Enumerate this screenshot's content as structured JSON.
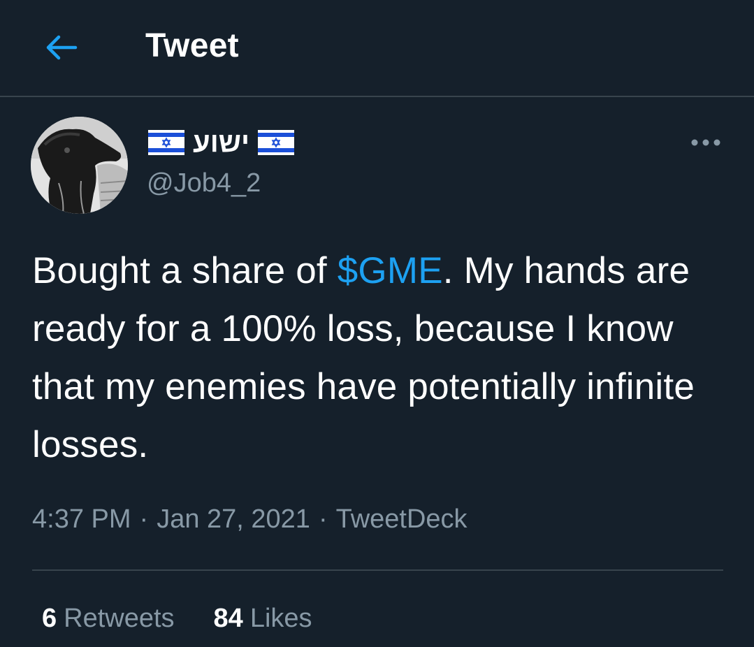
{
  "header": {
    "back_icon": "arrow-left-icon",
    "title": "Tweet"
  },
  "author": {
    "display_name": "ישוע",
    "handle": "@Job4_2",
    "flag_icon": "israel-flag-icon"
  },
  "tweet": {
    "text_before": "Bought a share of ",
    "cashtag": "$GME",
    "text_after": ". My hands are ready for a 100% loss, because I know that my enemies have potentially infinite losses."
  },
  "meta": {
    "time": "4:37 PM",
    "separator": "·",
    "date": "Jan 27, 2021",
    "source": "TweetDeck"
  },
  "stats": {
    "retweets_count": "6",
    "retweets_label": "Retweets",
    "likes_count": "84",
    "likes_label": "Likes"
  },
  "colors": {
    "background": "#15202b",
    "accent": "#1da1f2",
    "secondary_text": "#8899a6",
    "divider": "#38444d"
  }
}
